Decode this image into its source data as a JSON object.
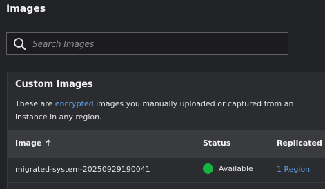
{
  "page": {
    "title": "Images"
  },
  "search": {
    "placeholder": "Search Images"
  },
  "custom_images": {
    "title": "Custom Images",
    "description_prefix": "These are ",
    "description_link": "encrypted",
    "description_line1_rest": " images you manually uploaded or captured from an",
    "description_line2": "instance in any region."
  },
  "table": {
    "columns": {
      "image": "Image",
      "status": "Status",
      "replicated": "Replicated"
    },
    "sort_direction": "ascending",
    "rows": [
      {
        "image": "migrated-system-20250929190041",
        "status": "Available",
        "status_color": "#17b33f",
        "replicated": "1 Region"
      }
    ]
  },
  "colors": {
    "background": "#222326",
    "card": "#2b2c30",
    "header": "#3a3b3f",
    "link": "#5aa0e6"
  }
}
